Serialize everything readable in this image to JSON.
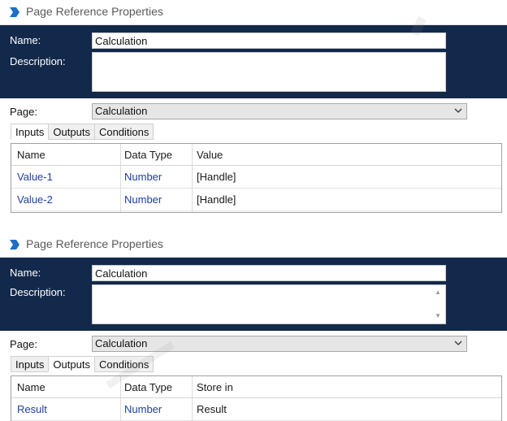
{
  "panels": [
    {
      "title": "Page Reference Properties",
      "name_label": "Name:",
      "name_value": "Calculation",
      "description_label": "Description:",
      "description_value": "",
      "page_label": "Page:",
      "page_value": "Calculation",
      "tabs": [
        "Inputs",
        "Outputs",
        "Conditions"
      ],
      "active_tab": "Inputs",
      "columns": [
        "Name",
        "Data Type",
        "Value"
      ],
      "rows": [
        {
          "name": "Value-1",
          "type": "Number",
          "value": "[Handle]"
        },
        {
          "name": "Value-2",
          "type": "Number",
          "value": "[Handle]"
        }
      ]
    },
    {
      "title": "Page Reference Properties",
      "name_label": "Name:",
      "name_value": "Calculation",
      "description_label": "Description:",
      "description_value": "",
      "page_label": "Page:",
      "page_value": "Calculation",
      "tabs": [
        "Inputs",
        "Outputs",
        "Conditions"
      ],
      "active_tab": "Outputs",
      "columns": [
        "Name",
        "Data Type",
        "Store in"
      ],
      "rows": [
        {
          "name": "Result",
          "type": "Number",
          "value": "Result"
        }
      ]
    }
  ],
  "colors": {
    "header_bg": "#13294b",
    "link_blue": "#1f3f9f",
    "app_icon": "#1f6fc6"
  },
  "icons": {
    "app": "blue-process-logo-icon",
    "dropdown": "chevron-down-icon"
  }
}
